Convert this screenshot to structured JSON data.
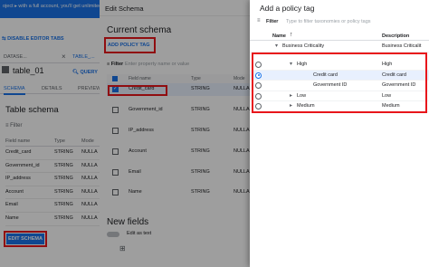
{
  "console": {
    "top_banner": "oject  ▸  with a full account, you'll get unlimited access",
    "disable_tabs": "DISABLE EDITOR TABS",
    "tabs": [
      "DATASE...",
      "TABLE_..."
    ],
    "table_name": "table_01",
    "query_label": "QUERY",
    "subtabs": [
      "SCHEMA",
      "DETAILS",
      "PREVIEW"
    ],
    "schema_title": "Table schema",
    "filter_label": "Filter",
    "columns": [
      "Field name",
      "Type",
      "Mode"
    ],
    "rows": [
      {
        "name": "Credit_card",
        "type": "STRING",
        "mode": "NULLA"
      },
      {
        "name": "Government_id",
        "type": "STRING",
        "mode": "NULLA"
      },
      {
        "name": "IP_address",
        "type": "STRING",
        "mode": "NULLA"
      },
      {
        "name": "Account",
        "type": "STRING",
        "mode": "NULLA"
      },
      {
        "name": "Email",
        "type": "STRING",
        "mode": "NULLA"
      },
      {
        "name": "Name",
        "type": "STRING",
        "mode": "NULLA"
      }
    ],
    "edit_schema_button": "EDIT SCHEMA"
  },
  "edit_schema": {
    "header": "Edit Schema",
    "current_schema": "Current schema",
    "add_policy_tag_button": "ADD POLICY TAG",
    "filter_label": "Filter",
    "filter_placeholder": "Enter property name or value",
    "columns": [
      "Field name",
      "Type",
      "Mode"
    ],
    "rows": [
      {
        "name": "Credit_card",
        "type": "STRING",
        "mode": "NULLA"
      },
      {
        "name": "Government_id",
        "type": "STRING",
        "mode": "NULLA"
      },
      {
        "name": "IP_address",
        "type": "STRING",
        "mode": "NULLA"
      },
      {
        "name": "Account",
        "type": "STRING",
        "mode": "NULLA"
      },
      {
        "name": "Email",
        "type": "STRING",
        "mode": "NULLA"
      },
      {
        "name": "Name",
        "type": "STRING",
        "mode": "NULLA"
      }
    ],
    "new_fields": "New fields",
    "edit_as_text": "Edit as text"
  },
  "policy_tag": {
    "title": "Add a policy tag",
    "filter_label": "Filter",
    "filter_placeholder": "Type to filter taxonomies or policy tags",
    "col_name": "Name",
    "col_description": "Description",
    "rows": [
      {
        "name": "Business Criticality",
        "desc": "Business Criticalit"
      },
      {
        "name": "High",
        "desc": "High"
      },
      {
        "name": "Credit card",
        "desc": "Credit card"
      },
      {
        "name": "Government ID",
        "desc": "Government ID"
      },
      {
        "name": "Low",
        "desc": "Low"
      },
      {
        "name": "Medium",
        "desc": "Medium"
      }
    ]
  },
  "colors": {
    "accent": "#1a73e8",
    "highlight_box": "#e8161b",
    "selected_row": "#e8f0fe"
  }
}
